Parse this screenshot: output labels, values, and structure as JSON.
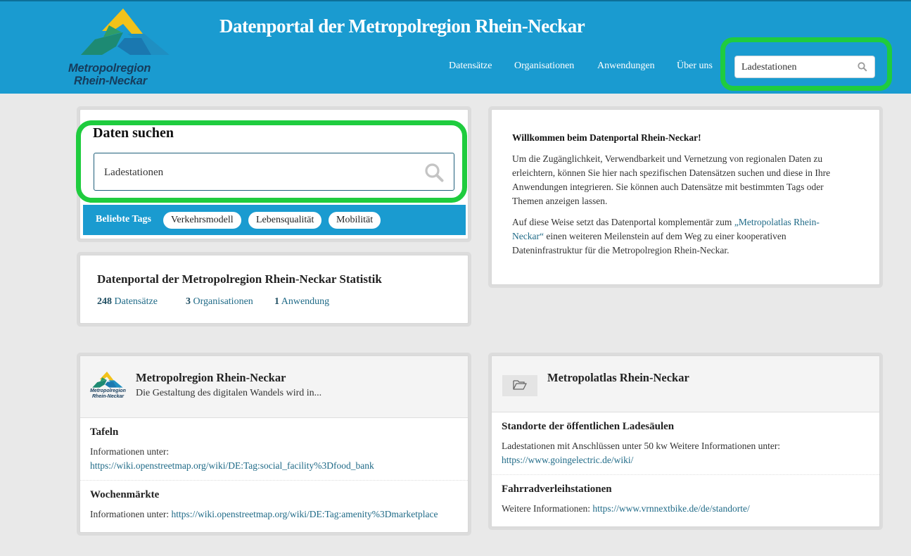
{
  "header": {
    "title": "Datenportal der Metropolregion Rhein-Neckar",
    "logo_line1": "Metropolregion",
    "logo_line2": "Rhein-Neckar",
    "nav": [
      "Datensätze",
      "Organisationen",
      "Anwendungen",
      "Über uns"
    ],
    "search_value": "Ladestationen"
  },
  "search": {
    "title": "Daten suchen",
    "value": "Ladestationen",
    "tags_label": "Beliebte Tags",
    "tags": [
      "Verkehrsmodell",
      "Lebensqualität",
      "Mobilität"
    ]
  },
  "stats": {
    "title": "Datenportal der Metropolregion Rhein-Neckar Statistik",
    "datasets_count": "248",
    "datasets_label": "Datensätze",
    "orgs_count": "3",
    "orgs_label": "Organisationen",
    "apps_count": "1",
    "apps_label": "Anwendung"
  },
  "welcome": {
    "heading": "Willkommen beim Datenportal Rhein-Neckar!",
    "p1": "Um die Zugänglichkeit, Verwendbarkeit und Vernetzung von regionalen Daten zu erleichtern, können Sie hier nach spezifischen Datensätzen suchen und diese in Ihre Anwendungen integrieren. Sie können auch Datensätze mit bestimmten Tags oder Themen anzeigen lassen.",
    "p2_before": "Auf diese Weise setzt das Datenportal komplementär zum ",
    "p2_link": "„Metropolatlas Rhein-Neckar“",
    "p2_after": " einen weiteren Meilenstein auf dem Weg zu einer kooperativen Dateninfrastruktur für die Metropolregion Rhein-Neckar."
  },
  "org_card": {
    "name": "Metropolregion Rhein-Neckar",
    "desc": "Die Gestaltung des digitalen Wandels wird in...",
    "logo_line1": "Metropolregion",
    "logo_line2": "Rhein-Neckar",
    "items": [
      {
        "title": "Tafeln",
        "text": "Informationen unter:",
        "link": "https://wiki.openstreetmap.org/wiki/DE:Tag:social_facility%3Dfood_bank"
      },
      {
        "title": "Wochenmärkte",
        "text": "Informationen unter:",
        "link": "https://wiki.openstreetmap.org/wiki/DE:Tag:amenity%3Dmarketplace"
      }
    ]
  },
  "atlas_card": {
    "name": "Metropolatlas Rhein-Neckar",
    "items": [
      {
        "title": "Standorte der öffentlichen Ladesäulen",
        "text": "Ladestationen mit Anschlüssen unter 50 kw Weitere Informationen unter:",
        "link": "https://www.goingelectric.de/wiki/"
      },
      {
        "title": "Fahrradverleihstationen",
        "text": "Weitere Informationen:",
        "link": "https://www.vrnnextbike.de/de/standorte/"
      }
    ]
  },
  "colors": {
    "header_bg": "#1a9bd0",
    "highlight": "#1fcc3e",
    "link": "#1f6a87"
  }
}
